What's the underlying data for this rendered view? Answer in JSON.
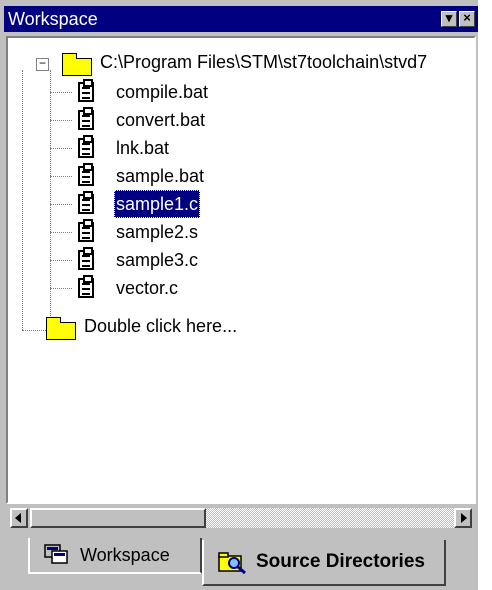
{
  "window": {
    "title": "Workspace"
  },
  "tree": {
    "root": {
      "label": "C:\\Program Files\\STM\\st7toolchain\\stvd7",
      "expander": "−"
    },
    "files": [
      {
        "label": "compile.bat",
        "selected": false
      },
      {
        "label": "convert.bat",
        "selected": false
      },
      {
        "label": "lnk.bat",
        "selected": false
      },
      {
        "label": "sample.bat",
        "selected": false
      },
      {
        "label": "sample1.c",
        "selected": true
      },
      {
        "label": "sample2.s",
        "selected": false
      },
      {
        "label": "sample3.c",
        "selected": false
      },
      {
        "label": "vector.c",
        "selected": false
      }
    ],
    "extra_folder": {
      "label": "Double click here..."
    }
  },
  "tabs": [
    {
      "label": "Workspace",
      "active": false,
      "icon": "workspace-icon"
    },
    {
      "label": "Source Directories",
      "active": true,
      "icon": "search-folder-icon"
    }
  ],
  "colors": {
    "title_bar": "#000080",
    "selection": "#000080",
    "chrome": "#c0c0c0",
    "folder": "#ffff00"
  }
}
